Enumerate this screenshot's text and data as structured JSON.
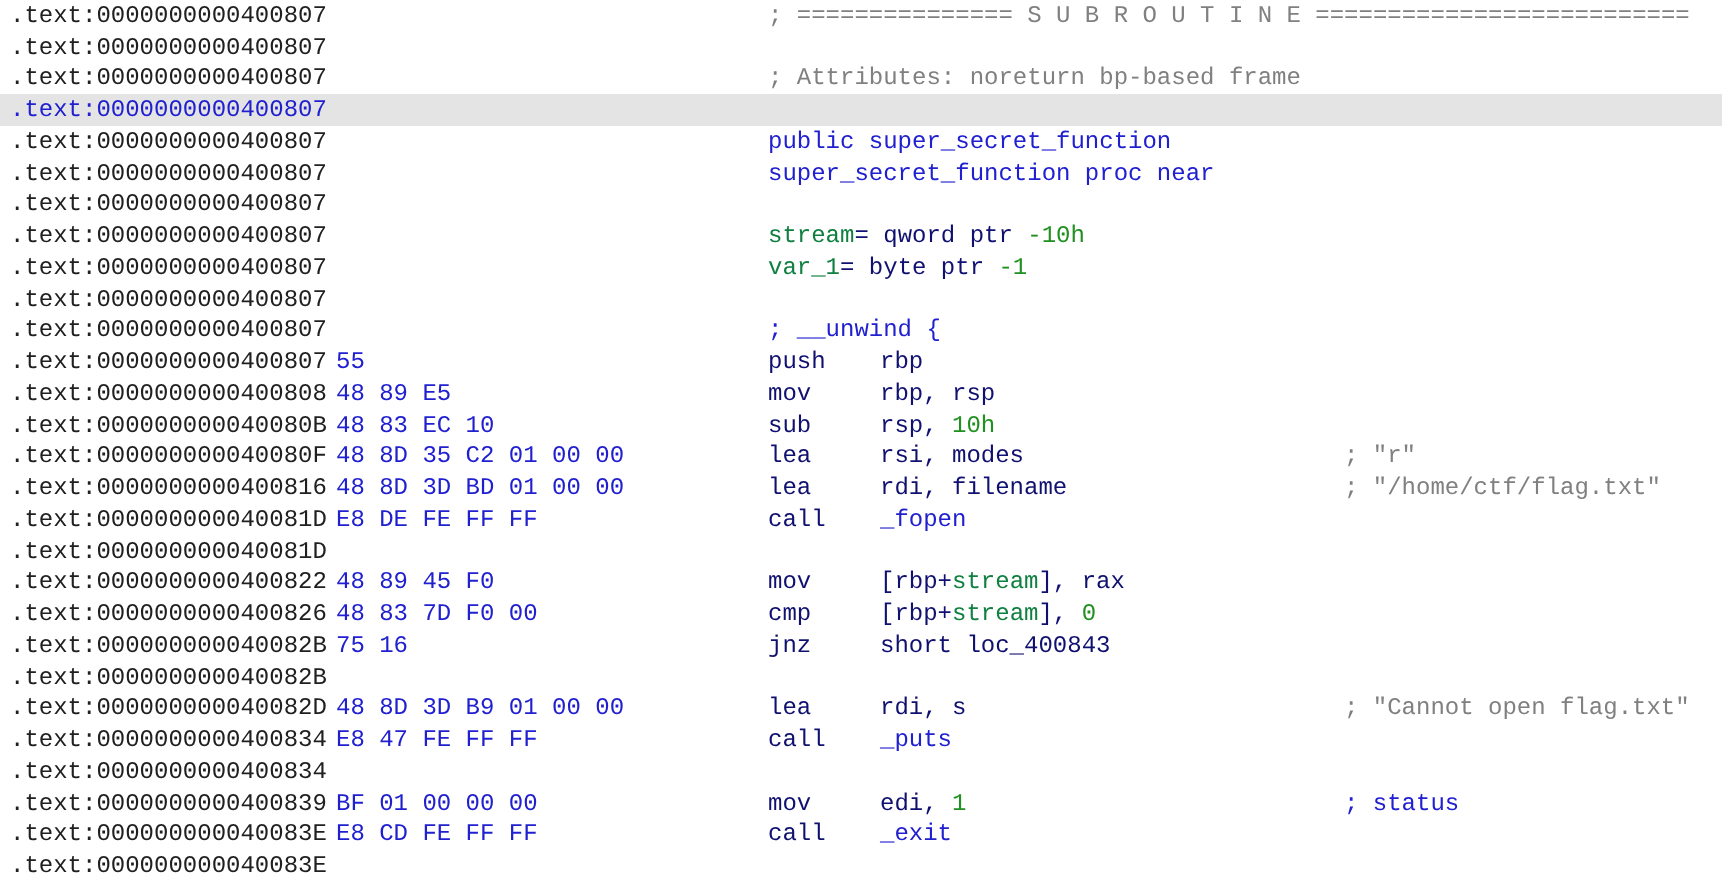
{
  "listing": [
    {
      "address": ".text:0000000000400807",
      "selected": false,
      "line": [
        {
          "kind": "comment",
          "text": "; =============== S U B R O U T I N E =========================="
        }
      ]
    },
    {
      "address": ".text:0000000000400807",
      "selected": false
    },
    {
      "address": ".text:0000000000400807",
      "selected": false,
      "line": [
        {
          "kind": "comment",
          "text": "; Attributes: noreturn bp-based frame"
        }
      ]
    },
    {
      "address": ".text:0000000000400807",
      "selected": true
    },
    {
      "address": ".text:0000000000400807",
      "selected": false,
      "line": [
        {
          "kind": "sym",
          "text": "public super_secret_function"
        }
      ]
    },
    {
      "address": ".text:0000000000400807",
      "selected": false,
      "line": [
        {
          "kind": "sym",
          "text": "super_secret_function proc near"
        }
      ]
    },
    {
      "address": ".text:0000000000400807",
      "selected": false
    },
    {
      "address": ".text:0000000000400807",
      "selected": false,
      "line": [
        {
          "kind": "var",
          "text": "stream"
        },
        {
          "kind": "plain",
          "text": "= qword ptr "
        },
        {
          "kind": "num",
          "text": "-10h"
        }
      ]
    },
    {
      "address": ".text:0000000000400807",
      "selected": false,
      "line": [
        {
          "kind": "var",
          "text": "var_1"
        },
        {
          "kind": "plain",
          "text": "= byte ptr "
        },
        {
          "kind": "num",
          "text": "-1"
        }
      ]
    },
    {
      "address": ".text:0000000000400807",
      "selected": false
    },
    {
      "address": ".text:0000000000400807",
      "selected": false,
      "line": [
        {
          "kind": "sym",
          "text": "; __unwind {"
        }
      ]
    },
    {
      "address": ".text:0000000000400807",
      "selected": false,
      "bytes": "55",
      "mnemonic": "push",
      "operands": [
        {
          "kind": "plain",
          "text": "rbp"
        }
      ]
    },
    {
      "address": ".text:0000000000400808",
      "selected": false,
      "bytes": "48 89 E5",
      "mnemonic": "mov",
      "operands": [
        {
          "kind": "plain",
          "text": "rbp, rsp"
        }
      ]
    },
    {
      "address": ".text:000000000040080B",
      "selected": false,
      "bytes": "48 83 EC 10",
      "mnemonic": "sub",
      "operands": [
        {
          "kind": "plain",
          "text": "rsp, "
        },
        {
          "kind": "num",
          "text": "10h"
        }
      ]
    },
    {
      "address": ".text:000000000040080F",
      "selected": false,
      "bytes": "48 8D 35 C2 01 00 00",
      "mnemonic": "lea",
      "operands": [
        {
          "kind": "plain",
          "text": "rsi, modes"
        }
      ],
      "comment": [
        {
          "kind": "comment",
          "text": "; \"r\""
        }
      ]
    },
    {
      "address": ".text:0000000000400816",
      "selected": false,
      "bytes": "48 8D 3D BD 01 00 00",
      "mnemonic": "lea",
      "operands": [
        {
          "kind": "plain",
          "text": "rdi, filename"
        }
      ],
      "comment": [
        {
          "kind": "comment",
          "text": "; \"/home/ctf/flag.txt\""
        }
      ]
    },
    {
      "address": ".text:000000000040081D",
      "selected": false,
      "bytes": "E8 DE FE FF FF",
      "mnemonic": "call",
      "operands": [
        {
          "kind": "sym",
          "text": "_fopen"
        }
      ]
    },
    {
      "address": ".text:000000000040081D",
      "selected": false
    },
    {
      "address": ".text:0000000000400822",
      "selected": false,
      "bytes": "48 89 45 F0",
      "mnemonic": "mov",
      "operands": [
        {
          "kind": "plain",
          "text": "[rbp+"
        },
        {
          "kind": "var",
          "text": "stream"
        },
        {
          "kind": "plain",
          "text": "], rax"
        }
      ]
    },
    {
      "address": ".text:0000000000400826",
      "selected": false,
      "bytes": "48 83 7D F0 00",
      "mnemonic": "cmp",
      "operands": [
        {
          "kind": "plain",
          "text": "[rbp+"
        },
        {
          "kind": "var",
          "text": "stream"
        },
        {
          "kind": "plain",
          "text": "], "
        },
        {
          "kind": "num",
          "text": "0"
        }
      ]
    },
    {
      "address": ".text:000000000040082B",
      "selected": false,
      "bytes": "75 16",
      "mnemonic": "jnz",
      "operands": [
        {
          "kind": "plain",
          "text": "short loc_400843"
        }
      ]
    },
    {
      "address": ".text:000000000040082B",
      "selected": false
    },
    {
      "address": ".text:000000000040082D",
      "selected": false,
      "bytes": "48 8D 3D B9 01 00 00",
      "mnemonic": "lea",
      "operands": [
        {
          "kind": "plain",
          "text": "rdi, s"
        }
      ],
      "comment": [
        {
          "kind": "comment",
          "text": "; \"Cannot open flag.txt\""
        }
      ]
    },
    {
      "address": ".text:0000000000400834",
      "selected": false,
      "bytes": "E8 47 FE FF FF",
      "mnemonic": "call",
      "operands": [
        {
          "kind": "sym",
          "text": "_puts"
        }
      ]
    },
    {
      "address": ".text:0000000000400834",
      "selected": false
    },
    {
      "address": ".text:0000000000400839",
      "selected": false,
      "bytes": "BF 01 00 00 00",
      "mnemonic": "mov",
      "operands": [
        {
          "kind": "plain",
          "text": "edi, "
        },
        {
          "kind": "num",
          "text": "1"
        }
      ],
      "comment": [
        {
          "kind": "sym",
          "text": "; status"
        }
      ]
    },
    {
      "address": ".text:000000000040083E",
      "selected": false,
      "bytes": "E8 CD FE FF FF",
      "mnemonic": "call",
      "operands": [
        {
          "kind": "sym",
          "text": "_exit"
        }
      ]
    },
    {
      "address": ".text:000000000040083E",
      "selected": false
    }
  ]
}
